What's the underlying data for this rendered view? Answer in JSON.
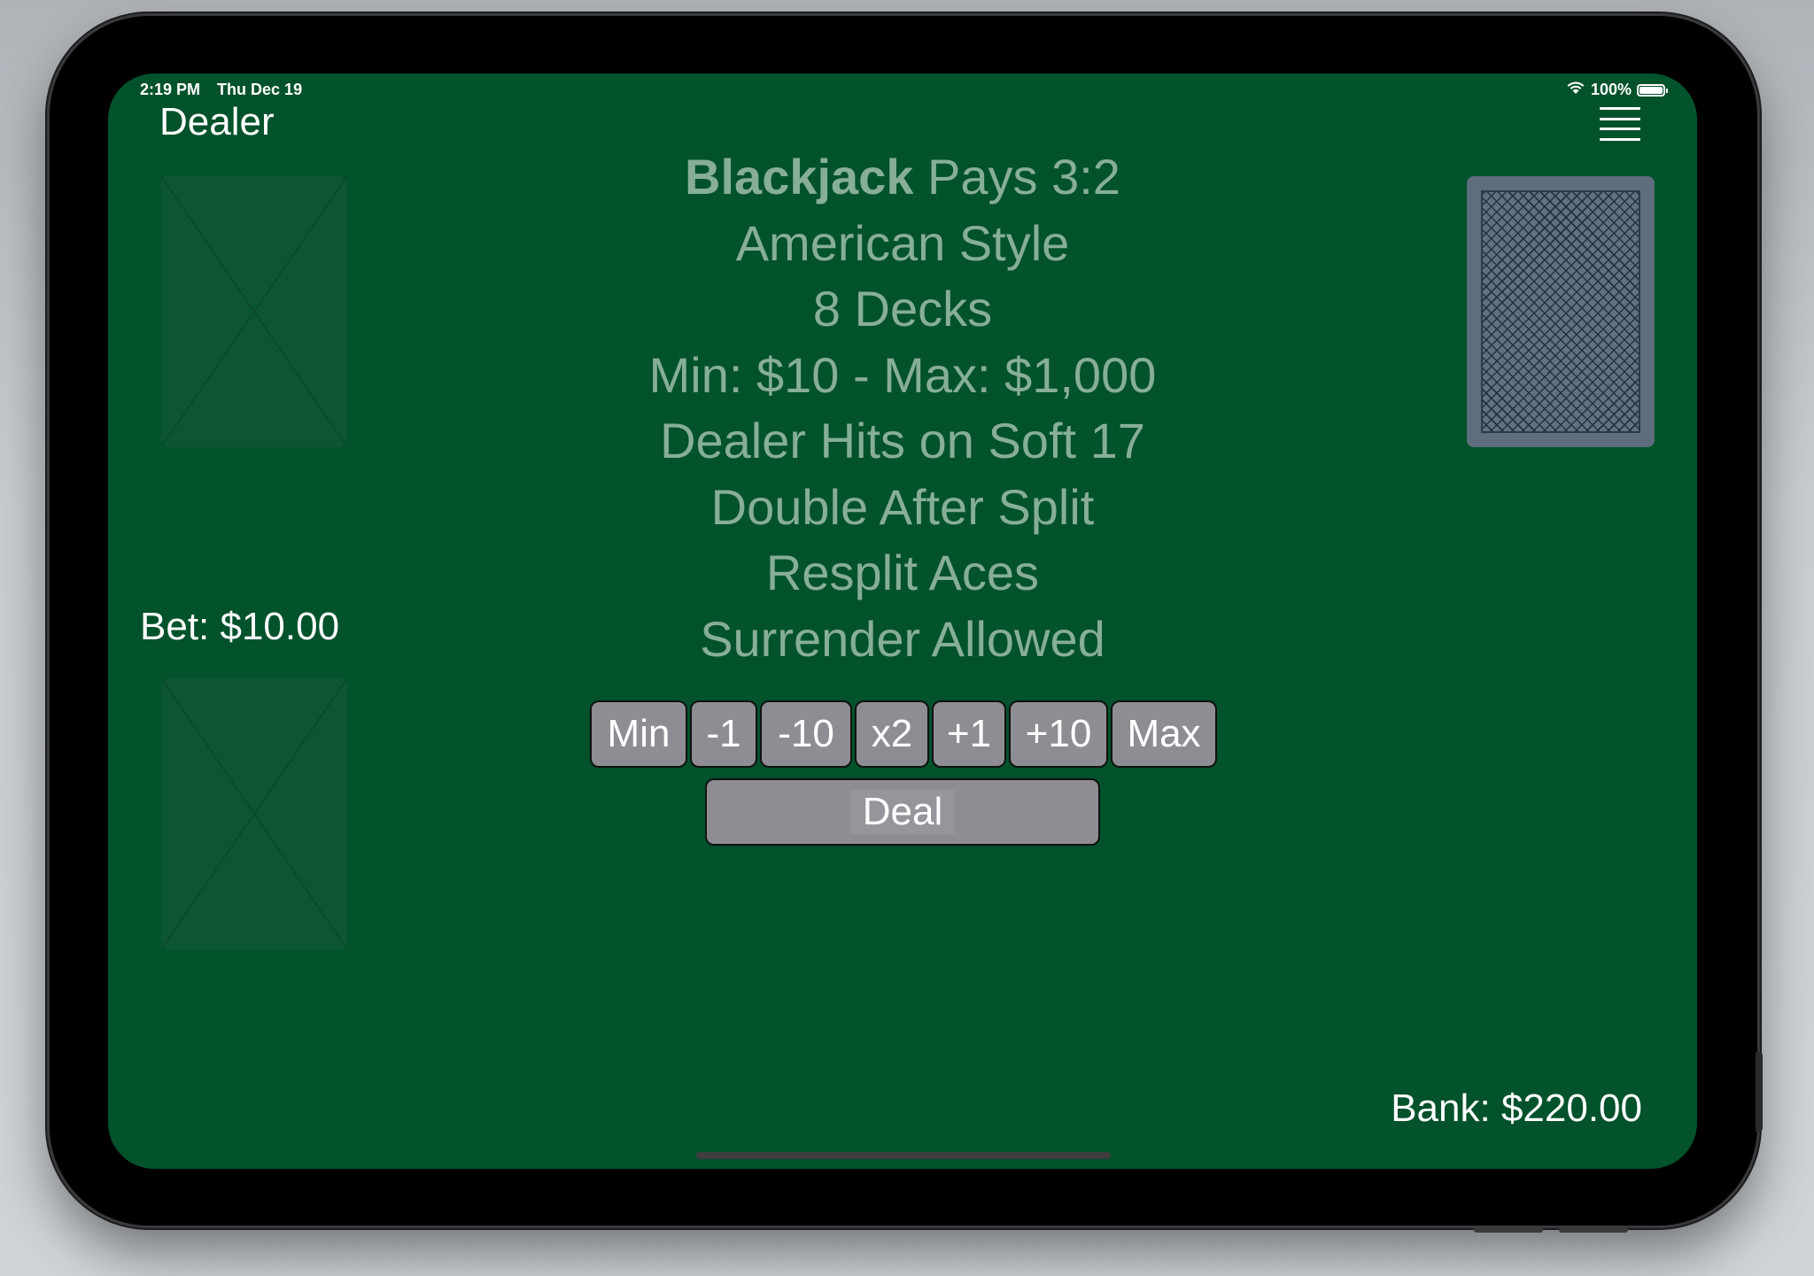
{
  "status_bar": {
    "time": "2:19 PM",
    "date": "Thu Dec 19",
    "battery": "100%",
    "battery_level": 1.0,
    "wifi_icon": "wifi-icon"
  },
  "dealer": {
    "label": "Dealer"
  },
  "menu": {
    "icon": "hamburger-menu-icon"
  },
  "rules": {
    "line1_bold": "Blackjack",
    "line1_rest": " Pays 3:2",
    "lines": [
      "American Style",
      "8 Decks",
      "Min: $10 - Max: $1,000",
      "Dealer Hits on Soft 17",
      "Double After Split",
      "Resplit Aces",
      "Surrender Allowed"
    ]
  },
  "bet": {
    "label": "Bet: $10.00"
  },
  "bank": {
    "label": "Bank: $220.00"
  },
  "bet_buttons": [
    "Min",
    "-1",
    "-10",
    "x2",
    "+1",
    "+10",
    "Max"
  ],
  "deal_button": {
    "label": "Deal"
  },
  "colors": {
    "table_felt": "#02522b",
    "rules_text": "#87ae98",
    "button_bg": "#8e8d93",
    "card_back": "#5e6e7d"
  }
}
